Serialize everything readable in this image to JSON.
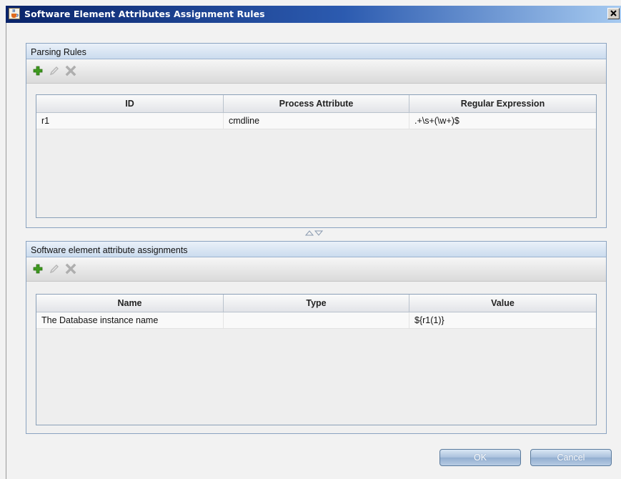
{
  "window": {
    "title": "Software Element Attributes Assignment Rules"
  },
  "parsing_rules": {
    "title": "Parsing Rules",
    "toolbar": {
      "add_icon": "plus-icon",
      "edit_icon": "pencil-icon",
      "delete_icon": "x-icon"
    },
    "columns": [
      "ID",
      "Process Attribute",
      "Regular Expression"
    ],
    "rows": [
      {
        "id": "r1",
        "process_attribute": "cmdline",
        "regex": ".+\\s+(\\w+)$"
      }
    ]
  },
  "assignments": {
    "title": "Software element attribute assignments",
    "toolbar": {
      "add_icon": "plus-icon",
      "edit_icon": "pencil-icon",
      "delete_icon": "x-icon"
    },
    "columns": [
      "Name",
      "Type",
      "Value"
    ],
    "rows": [
      {
        "name": "The Database instance name",
        "type": "",
        "value": "${r1(1)}"
      }
    ]
  },
  "buttons": {
    "ok": "OK",
    "cancel": "Cancel"
  },
  "colors": {
    "title_bar_start": "#0a246a",
    "panel_header": "#cbdcee",
    "button_blue": "#a9c0dc",
    "add_icon_green": "#3e9a1f"
  }
}
